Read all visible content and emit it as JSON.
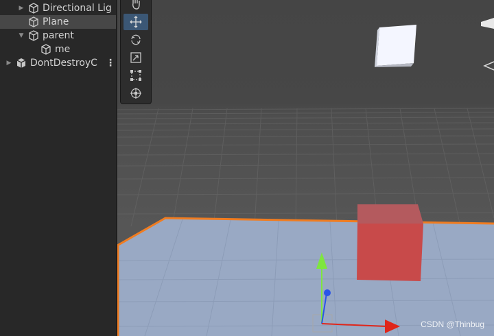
{
  "hierarchy": {
    "items": [
      {
        "label": "Directional Lig",
        "expanded": false,
        "selected": false
      },
      {
        "label": "Plane",
        "selected": true
      },
      {
        "label": "parent",
        "expanded": true,
        "selected": false
      },
      {
        "label": "me",
        "selected": false
      },
      {
        "label": "DontDestroyC",
        "expanded": false,
        "selected": false
      }
    ],
    "menu_icon": "kebab-menu-icon"
  },
  "toolbar": {
    "tools": [
      {
        "name": "hand-tool",
        "icon": "hand-icon"
      },
      {
        "name": "move-tool",
        "icon": "move-arrows-icon",
        "active": true
      },
      {
        "name": "rotate-tool",
        "icon": "rotate-icon"
      },
      {
        "name": "scale-tool",
        "icon": "scale-icon"
      },
      {
        "name": "rect-tool",
        "icon": "rect-transform-icon"
      },
      {
        "name": "transform-tool",
        "icon": "transform-icon"
      }
    ]
  },
  "scene": {
    "colors": {
      "plane": "#99a9c4",
      "outline": "#f07c20",
      "red_cube": "#c84a4a",
      "white_cube": "#f4f6ff",
      "gizmo_x": "#e0261a",
      "gizmo_y": "#7ee63f",
      "gizmo_z": "#2a54e8"
    }
  },
  "watermark": "CSDN @Thinbug"
}
